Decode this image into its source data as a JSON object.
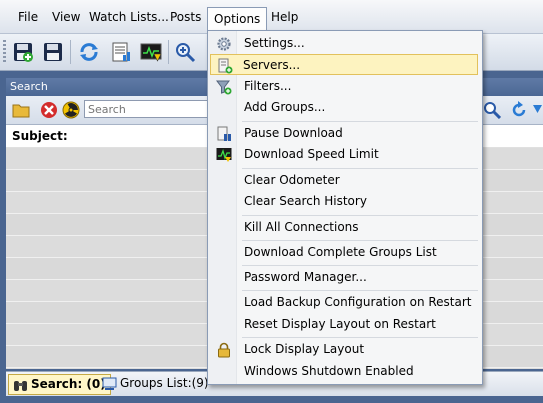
{
  "menubar": {
    "items": [
      "File",
      "View",
      "Watch Lists...",
      "Posts",
      "Options",
      "Help"
    ],
    "active": "Options"
  },
  "toolbar": {
    "icons": [
      "save-green-icon",
      "save-icon",
      "refresh-icon",
      "document-icon",
      "download-speed-icon",
      "zoom-in-icon"
    ]
  },
  "search_panel": {
    "title": "Search",
    "search_placeholder": "Search",
    "column_subject": "Subject:"
  },
  "status_tabs": {
    "search_tab": "Search: (0)",
    "groups_tab": "Groups List:(9)"
  },
  "options_menu": {
    "items": [
      {
        "label": "Settings...",
        "icon": "gear-icon"
      },
      {
        "label": "Servers...",
        "icon": "server-icon",
        "highlighted": true
      },
      {
        "label": "Filters...",
        "icon": "filter-icon"
      },
      {
        "label": "Add Groups...",
        "icon": ""
      },
      {
        "label": "Pause Download",
        "icon": "pause-icon"
      },
      {
        "label": "Download Speed Limit",
        "icon": "speed-icon"
      },
      {
        "label": "Clear Odometer",
        "icon": ""
      },
      {
        "label": "Clear Search History",
        "icon": ""
      },
      {
        "label": "Kill All Connections",
        "icon": ""
      },
      {
        "label": "Download Complete Groups List",
        "icon": ""
      },
      {
        "label": "Password Manager...",
        "icon": ""
      },
      {
        "label": "Load Backup Configuration on Restart",
        "icon": ""
      },
      {
        "label": "Reset Display Layout on Restart",
        "icon": ""
      },
      {
        "label": "Lock Display Layout",
        "icon": "lock-icon"
      },
      {
        "label": "Windows Shutdown Enabled",
        "icon": ""
      }
    ]
  },
  "colors": {
    "highlight": "#fdf3c0",
    "highlight_border": "#e2c15c",
    "background": "#4a6590"
  }
}
